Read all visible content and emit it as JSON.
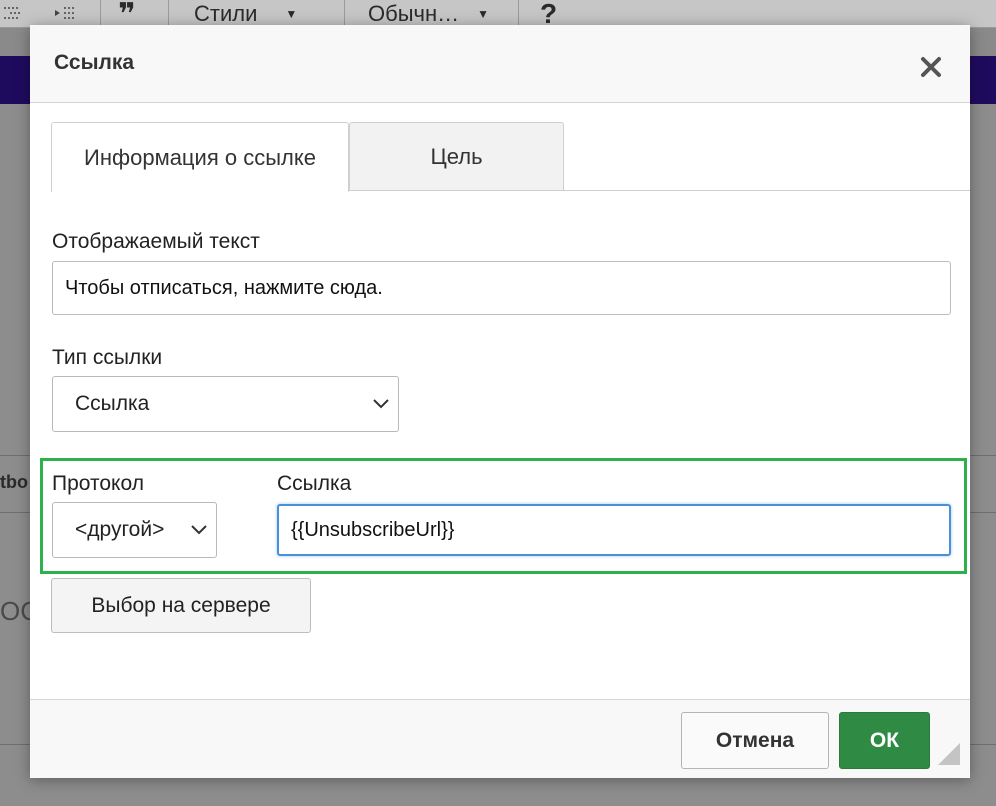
{
  "editor_toolbar": {
    "styles_label": "Стили",
    "format_label": "Обычн…",
    "help_label": "?",
    "quote_glyph": "❞"
  },
  "background_fragments": {
    "left_text": "tbo",
    "left_glyph": "ОС"
  },
  "dialog": {
    "title": "Ссылка",
    "tabs": [
      {
        "label": "Информация о ссылке",
        "active": true
      },
      {
        "label": "Цель",
        "active": false
      }
    ],
    "display_text": {
      "label": "Отображаемый текст",
      "value": "Чтобы отписаться, нажмите сюда."
    },
    "link_type": {
      "label": "Тип ссылки",
      "selected": "Ссылка"
    },
    "protocol": {
      "label": "Протокол",
      "selected": "<другой>"
    },
    "url": {
      "label": "Ссылка",
      "value": "{{UnsubscribeUrl}}"
    },
    "browse_server_label": "Выбор на сервере",
    "cancel_label": "Отмена",
    "ok_label": "ОК"
  },
  "colors": {
    "ok_button": "#2f8b44",
    "highlight_border": "#2db14a",
    "focus_border": "#4a90d9",
    "header_band": "#1f0b5e"
  }
}
